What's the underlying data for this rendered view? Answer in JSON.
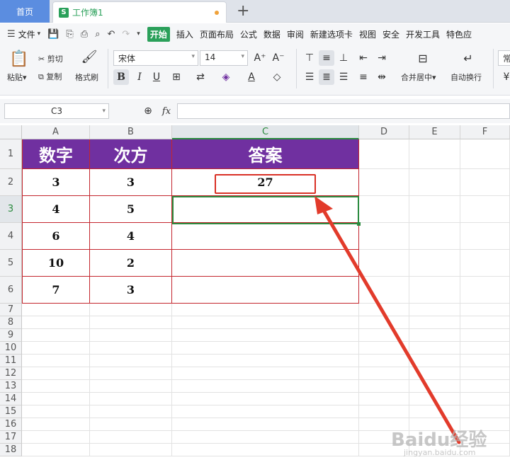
{
  "tabs": {
    "home": "首页",
    "workbook": "工作簿1",
    "workbook_icon": "S",
    "new_tab": "+"
  },
  "menubar": {
    "file": "文件",
    "items": [
      "开始",
      "插入",
      "页面布局",
      "公式",
      "数据",
      "审阅",
      "新建选项卡",
      "视图",
      "安全",
      "开发工具",
      "特色应"
    ]
  },
  "ribbon": {
    "paste": "粘贴",
    "cut": "剪切",
    "copy": "复制",
    "format_painter": "格式刷",
    "font_name": "宋体",
    "font_size": "14",
    "bold": "B",
    "italic": "I",
    "underline": "U",
    "merge_center": "合并居中",
    "wrap_text": "自动换行",
    "normal": "常"
  },
  "formula_bar": {
    "name_box": "C3",
    "fx": "fx",
    "content": ""
  },
  "columns": [
    "A",
    "B",
    "C",
    "D",
    "E",
    "F"
  ],
  "rows": [
    "1",
    "2",
    "3",
    "4",
    "5",
    "6",
    "7",
    "8",
    "9",
    "10",
    "11",
    "12",
    "13",
    "14",
    "15",
    "16",
    "17",
    "18"
  ],
  "table": {
    "headers": [
      "数字",
      "次方",
      "答案"
    ],
    "data": [
      [
        "3",
        "3",
        "27"
      ],
      [
        "4",
        "5",
        ""
      ],
      [
        "6",
        "4",
        ""
      ],
      [
        "10",
        "2",
        ""
      ],
      [
        "7",
        "3",
        ""
      ]
    ]
  },
  "annotation_color": "#d93025",
  "header_fill": "#7030a0",
  "watermark": {
    "main": "Baidu经验",
    "sub": "jingyan.baidu.com"
  }
}
